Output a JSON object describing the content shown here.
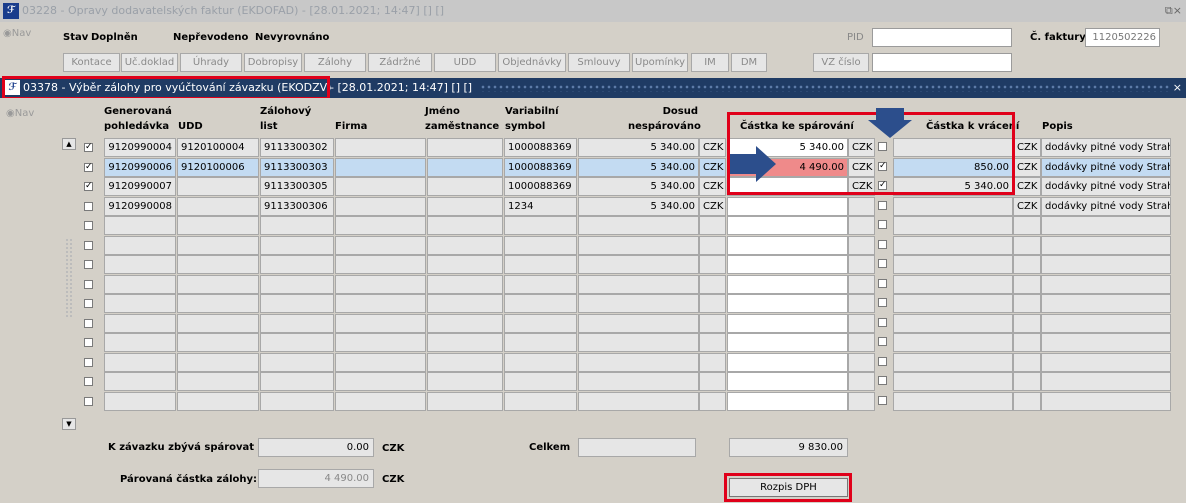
{
  "outer_window": {
    "title": "03228 - Opravy dodavatelských faktur (EKDOFAD) - [28.01.2021; 14:47] [] []",
    "nav_label": "Nav",
    "status_labels": [
      "Stav",
      "Doplněn",
      "Nepřevodeno",
      "Nevyrovnáno"
    ],
    "buttons": [
      "Kontace",
      "Uč.doklad",
      "Úhrady",
      "Dobropisy",
      "Zálohy",
      "Zádržné",
      "UDD",
      "Objednávky",
      "Smlouvy",
      "Upomínky",
      "IM",
      "DM"
    ],
    "pid_label": "PID",
    "vz_label": "VZ číslo",
    "faktura_label": "Č. faktury",
    "faktura_value": "1120502226"
  },
  "inner_window": {
    "title": "03378 - Výběr zálohy pro vyúčtování závazku (EKODZV)",
    "title_suffix": "- [28.01.2021; 14:47] [] []",
    "close_glyph": "×",
    "nav_label": "Nav",
    "columns": {
      "gen_pohledavka": "Generovaná\npohledávka",
      "udd": "UDD",
      "zalohovy_list": "Zálohový\nlist",
      "firma": "Firma",
      "jmeno": "Jméno\nzaměstnance",
      "vs": "Variabilní\nsymbol",
      "dosud": "Dosud\nnespárováno",
      "castka_sparovani": "Částka ke spárování",
      "castka_vraceni": "Částka k vrácení",
      "popis": "Popis"
    },
    "rows": [
      {
        "checked": true,
        "gen": "9120990004",
        "udd": "9120100004",
        "zal": "9113300302",
        "firma": "",
        "jmeno": "",
        "vs": "1000088369",
        "dosud": "5 340.00",
        "mena1": "CZK",
        "sparovani": "5 340.00",
        "mena2": "CZK",
        "vrac_checked": false,
        "vraceni": "",
        "mena3": "CZK",
        "popis": "dodávky pitné vody Straho"
      },
      {
        "checked": true,
        "gen": "9120990006",
        "udd": "9120100006",
        "zal": "9113300303",
        "firma": "",
        "jmeno": "",
        "vs": "1000088369",
        "dosud": "5 340.00",
        "mena1": "CZK",
        "sparovani": "4 490.00",
        "mena2": "CZK",
        "vrac_checked": true,
        "vraceni": "850.00",
        "mena3": "CZK",
        "popis": "dodávky pitné vody Straho"
      },
      {
        "checked": true,
        "gen": "9120990007",
        "udd": "",
        "zal": "9113300305",
        "firma": "",
        "jmeno": "",
        "vs": "1000088369",
        "dosud": "5 340.00",
        "mena1": "CZK",
        "sparovani": "",
        "mena2": "CZK",
        "vrac_checked": true,
        "vraceni": "5 340.00",
        "mena3": "CZK",
        "popis": "dodávky pitné vody Straho"
      },
      {
        "checked": false,
        "gen": "9120990008",
        "udd": "",
        "zal": "9113300306",
        "firma": "",
        "jmeno": "",
        "vs": "1234",
        "dosud": "5 340.00",
        "mena1": "CZK",
        "sparovani": "",
        "mena2": "",
        "vrac_checked": false,
        "vraceni": "",
        "mena3": "CZK",
        "popis": "dodávky pitné vody Straho"
      }
    ],
    "empty_row_count": 10,
    "summary": {
      "zbyva_label": "K závazku zbývá spárovat",
      "zbyva_value": "0.00",
      "zbyva_currency": "CZK",
      "celkem_label": "Celkem",
      "celkem_value": "9 830.00",
      "parovana_label": "Párovaná částka zálohy:",
      "parovana_value": "4 490.00",
      "parovana_currency": "CZK"
    },
    "rozpis_button": "Rozpis DPH"
  },
  "colors": {
    "inner_title_bg": "#1f3b64",
    "selected_row": "#c3dbf2",
    "highlight_red": "#e0001a",
    "arrow_blue": "#2c4e8c",
    "red_cell": "#ef8a8a"
  }
}
